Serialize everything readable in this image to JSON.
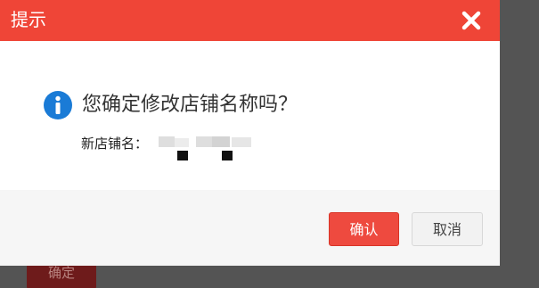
{
  "background": {
    "confirm_label": "确定"
  },
  "dialog": {
    "title": "提示",
    "close_icon": "close-icon",
    "info_icon": "info-icon",
    "question": "您确定修改店铺名称吗？",
    "shop_name_label": "新店铺名：",
    "buttons": {
      "ok": "确认",
      "cancel": "取消"
    }
  },
  "colors": {
    "header": "#ef4537",
    "primary_button": "#ee4a3f",
    "info_icon": "#1a7bd6",
    "overlay": "#545454"
  }
}
